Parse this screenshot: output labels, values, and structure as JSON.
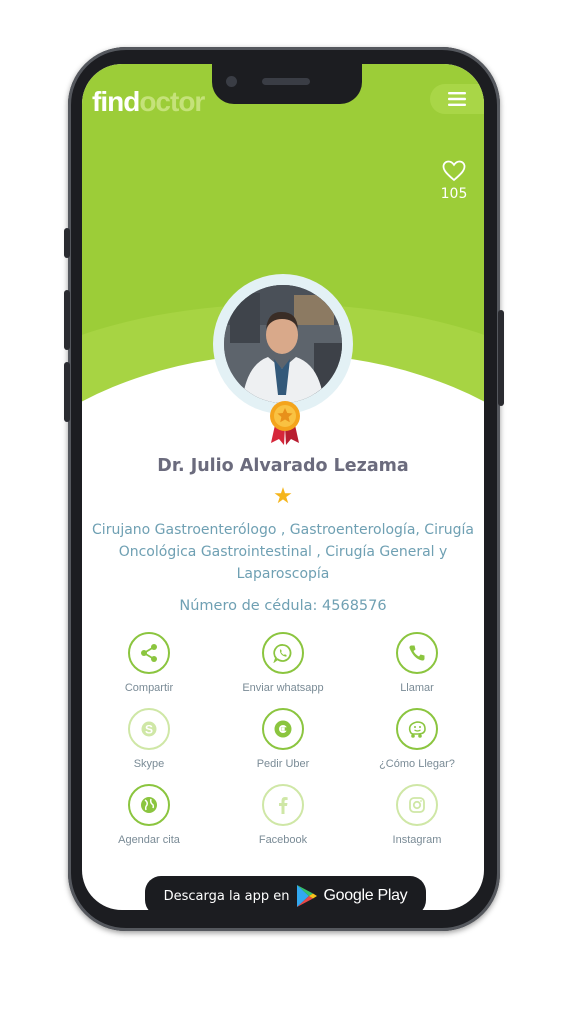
{
  "app": {
    "logo_part1": "find",
    "logo_part2": "octor"
  },
  "header": {
    "menu_icon": "hamburger-icon",
    "favorites_icon": "heart-icon",
    "favorites_count": "105"
  },
  "doctor": {
    "name": "Dr. Julio Alvarado Lezama",
    "rating_stars": "★",
    "specialties": "Cirujano Gastroenterólogo ,  Gastroenterología, Cirugía Oncológica Gastrointestinal ,  Cirugía General y Laparoscopía",
    "cedula": "Número de cédula: 4568576"
  },
  "actions": [
    {
      "label": "Compartir",
      "icon": "share-icon"
    },
    {
      "label": "Enviar whatsapp",
      "icon": "whatsapp-icon"
    },
    {
      "label": "Llamar",
      "icon": "phone-icon"
    },
    {
      "label": "Skype",
      "icon": "skype-icon"
    },
    {
      "label": "Pedir Uber",
      "icon": "uber-icon"
    },
    {
      "label": "¿Cómo Llegar?",
      "icon": "waze-icon"
    },
    {
      "label": "Agendar cita",
      "icon": "globe-icon"
    },
    {
      "label": "Facebook",
      "icon": "facebook-icon"
    },
    {
      "label": "Instagram",
      "icon": "instagram-icon"
    }
  ],
  "store_badge": {
    "prefix": "Descarga la app en",
    "store": "Google Play",
    "icon": "google-play-icon"
  },
  "colors": {
    "brand_green": "#9ccd38",
    "accent_text": "#6fa0b3",
    "name_text": "#6b6b7d",
    "star": "#f5b51c"
  }
}
